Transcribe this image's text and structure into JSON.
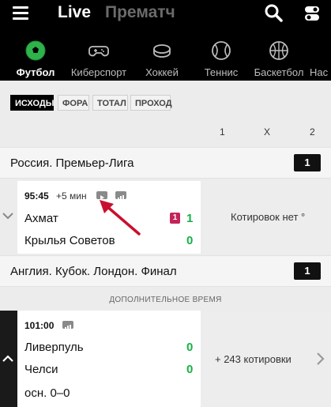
{
  "header": {
    "live_tab": "Live",
    "prematch_tab": "Прематч"
  },
  "sports": [
    {
      "label": "Футбол",
      "active": true
    },
    {
      "label": "Киберспорт"
    },
    {
      "label": "Хоккей"
    },
    {
      "label": "Теннис"
    },
    {
      "label": "Баскетбол"
    },
    {
      "label": "Нас"
    }
  ],
  "filters": [
    "ИСХОДЫ",
    "ФОРА",
    "ТОТАЛ",
    "ПРОХОД"
  ],
  "columns": [
    "1",
    "X",
    "2"
  ],
  "leagues": [
    {
      "name": "Россия. Премьер-Лига",
      "count": "1",
      "match": {
        "time": "95:45",
        "extra": "+5 мин",
        "team1": "Ахмат",
        "team2": "Крылья Советов",
        "red_card": "1",
        "score1": "1",
        "score2": "0",
        "odds": "Котировок нет °"
      }
    },
    {
      "name": "Англия. Кубок. Лондон. Финал",
      "count": "1",
      "match": {
        "stage": "ДОПОЛНИТЕЛЬНОЕ ВРЕМЯ",
        "time": "101:00",
        "team1": "Ливерпуль",
        "team2": "Челси",
        "score1": "0",
        "score2": "0",
        "series": "осн. 0–0",
        "odds": "+ 243 котировки"
      }
    }
  ],
  "colors": {
    "accent_green": "#17b045",
    "red_card": "#c4245a",
    "annotation_arrow": "#c8102e"
  }
}
